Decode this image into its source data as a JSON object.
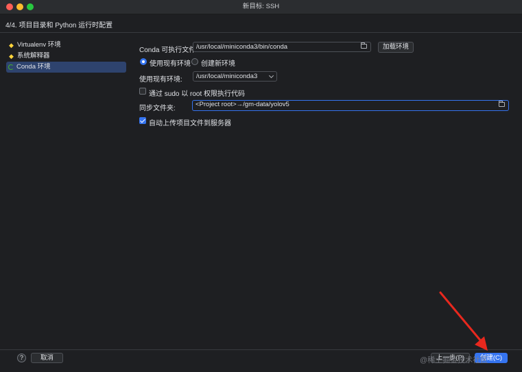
{
  "window": {
    "title": "新目标: SSH"
  },
  "header": {
    "step": "4/4. 项目目录和 Python 运行时配置"
  },
  "sidebar": {
    "items": [
      {
        "label": "Virtualenv 环境",
        "icon": "python-icon",
        "selected": false
      },
      {
        "label": "系统解释器",
        "icon": "python-icon",
        "selected": false
      },
      {
        "label": "Conda 环境",
        "icon": "conda-icon",
        "selected": true
      }
    ]
  },
  "form": {
    "conda_exec_label": "Conda 可执行文件:",
    "conda_exec_value": "/usr/local/miniconda3/bin/conda",
    "load_env_button": "加载环境",
    "use_existing_label": "使用现有环境",
    "create_new_label": "创建新环境",
    "existing_env_label": "使用现有环境:",
    "existing_env_value": "/usr/local/miniconda3",
    "sudo_label": "通过 sudo 以 root 权限执行代码",
    "sudo_checked": false,
    "sync_folder_label": "同步文件夹:",
    "sync_folder_value": "<Project root>→/gm-data/yolov5",
    "auto_upload_label": "自动上传项目文件到服务器",
    "auto_upload_checked": true
  },
  "footer": {
    "help_label": "?",
    "cancel_button": "取消",
    "prev_button": "上一步(P)",
    "create_button": "创建(C)"
  },
  "watermark": "@稀土掘金技术社区",
  "colors": {
    "accent": "#3574f0",
    "arrow": "#e8281e",
    "background": "#1e1f22"
  }
}
